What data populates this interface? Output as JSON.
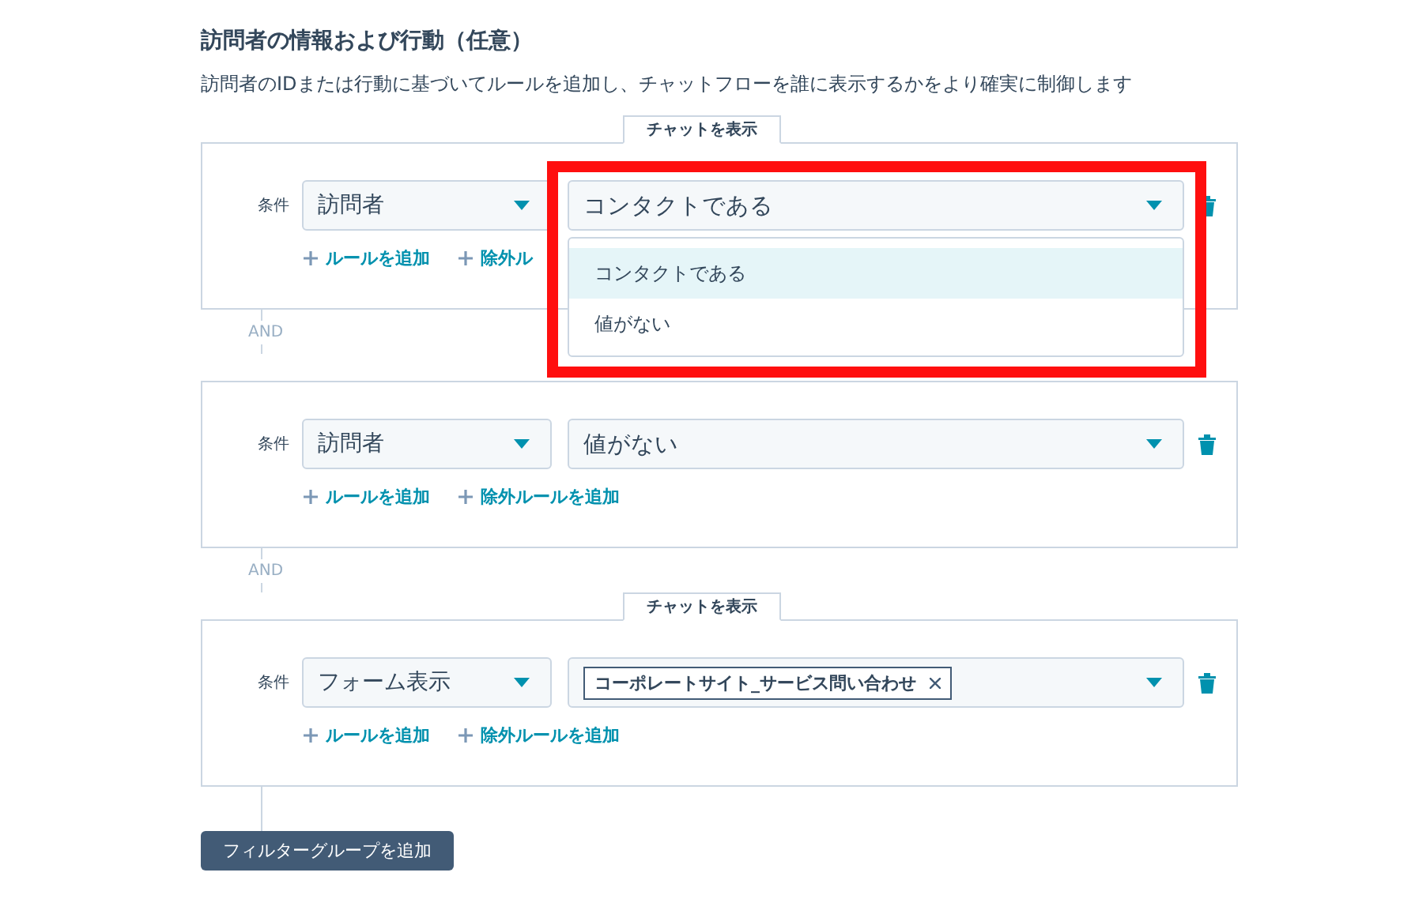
{
  "section": {
    "title": "訪問者の情報および行動（任意）",
    "description": "訪問者のIDまたは行動に基づいてルールを追加し、チャットフローを誰に表示するかをより確実に制御します"
  },
  "groups": [
    {
      "tab_label": "チャットを表示",
      "rule": {
        "label": "条件",
        "property": "訪問者",
        "value": {
          "kind": "text",
          "text": "コンタクトである"
        },
        "annotated": true,
        "menu": [
          {
            "label": "コンタクトである",
            "selected": true
          },
          {
            "label": "値がない",
            "selected": false
          }
        ]
      },
      "links": [
        "ルールを追加",
        "除外ル"
      ]
    },
    {
      "joiner": "AND",
      "rule": {
        "label": "条件",
        "property": "訪問者",
        "value": {
          "kind": "text",
          "text": "値がない"
        }
      },
      "links": [
        "ルールを追加",
        "除外ルールを追加"
      ]
    },
    {
      "joiner": "AND",
      "tab_label": "チャットを表示",
      "rule": {
        "label": "条件",
        "property": "フォーム表示",
        "value": {
          "kind": "chips",
          "chips": [
            {
              "label": "コーポレートサイト_サービス問い合わせ",
              "removable": true
            }
          ]
        }
      },
      "links": [
        "ルールを追加",
        "除外ルールを追加"
      ]
    }
  ],
  "add_group_button": "フィルターグループを追加"
}
